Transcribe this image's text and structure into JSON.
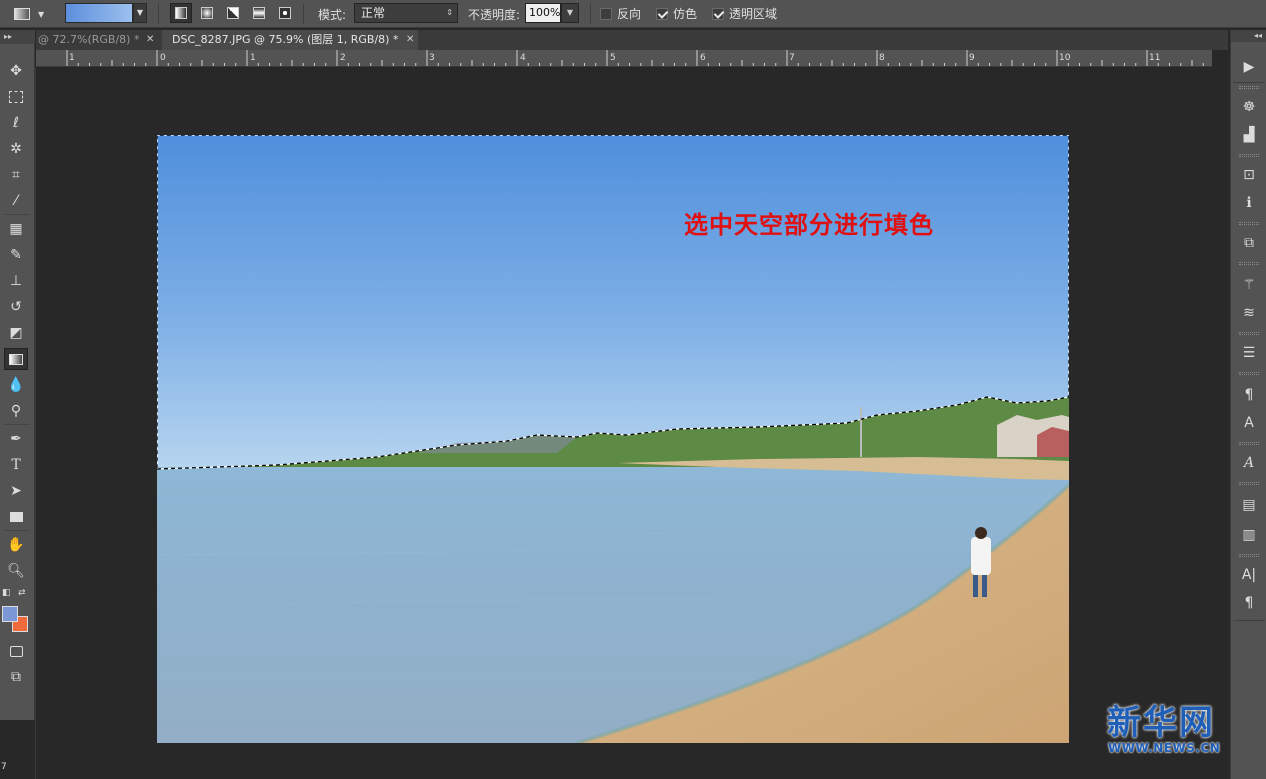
{
  "options_bar": {
    "mode_label": "模式:",
    "mode_value": "正常",
    "opacity_label": "不透明度:",
    "opacity_value": "100%",
    "checkboxes": [
      {
        "label": "反向",
        "checked": false
      },
      {
        "label": "仿色",
        "checked": true
      },
      {
        "label": "透明区域",
        "checked": true
      }
    ],
    "gradient_colors": [
      "#5d8fdd",
      "#9cc0ee"
    ]
  },
  "tabs": [
    {
      "label": "@ 72.7%(RGB/8) *",
      "active": false
    },
    {
      "label": "DSC_8287.JPG @ 75.9% (图层 1, RGB/8) *",
      "active": true
    }
  ],
  "ruler": {
    "labels": [
      "1",
      "0",
      "1",
      "2",
      "3",
      "4",
      "5",
      "6",
      "7",
      "8",
      "9",
      "10",
      "11"
    ]
  },
  "swatches": {
    "foreground": "#7b97d6",
    "background": "#f06a3c"
  },
  "canvas": {
    "caption": "选中天空部分进行填色"
  },
  "watermark": {
    "text": "新华网",
    "url": "WWW.NEWS.CN",
    "color": "#1f5fb8"
  },
  "side_ruler_digit": "7"
}
